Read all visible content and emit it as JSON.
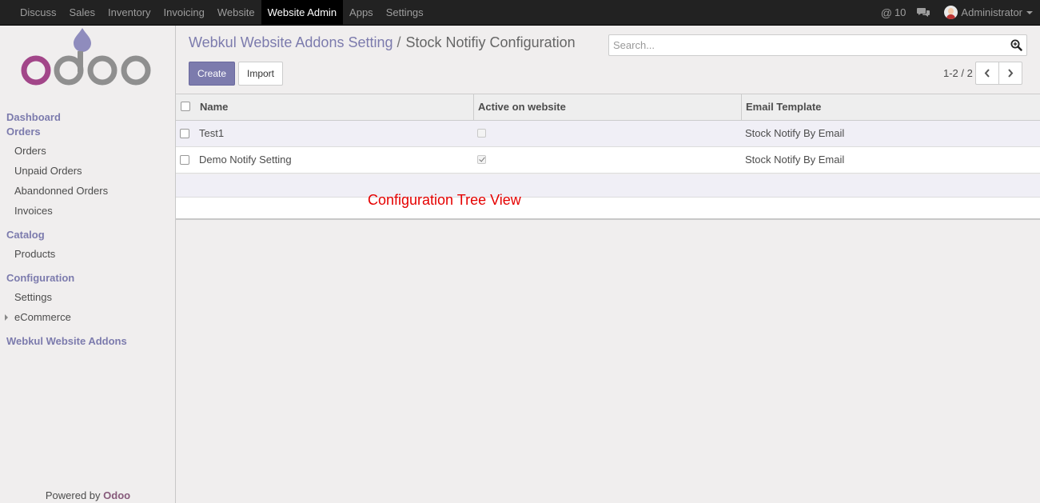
{
  "topbar": {
    "menu": [
      "Discuss",
      "Sales",
      "Inventory",
      "Invoicing",
      "Website",
      "Website Admin",
      "Apps",
      "Settings"
    ],
    "active_menu": "Website Admin",
    "mentions_count": "10",
    "mention_icon": "@",
    "user_name": "Administrator"
  },
  "sidebar": {
    "dashboard": "Dashboard",
    "orders_section": "Orders",
    "orders_items": [
      "Orders",
      "Unpaid Orders",
      "Abandonned Orders",
      "Invoices"
    ],
    "catalog_section": "Catalog",
    "catalog_items": [
      "Products"
    ],
    "configuration_section": "Configuration",
    "configuration_items": [
      "Settings",
      "eCommerce"
    ],
    "webkul_section": "Webkul Website Addons",
    "powered_prefix": "Powered by ",
    "powered_brand": "Odoo"
  },
  "breadcrumb": {
    "parent": "Webkul Website Addons Setting",
    "separator": "/",
    "current": "Stock Notifiy Configuration"
  },
  "search": {
    "placeholder": "Search..."
  },
  "buttons": {
    "create": "Create",
    "import": "Import"
  },
  "pager": {
    "value": "1-2 / 2"
  },
  "table": {
    "columns": [
      "Name",
      "Active on website",
      "Email Template"
    ],
    "rows": [
      {
        "name": "Test1",
        "active": false,
        "template": "Stock Notify By Email"
      },
      {
        "name": "Demo Notify Setting",
        "active": true,
        "template": "Stock Notify By Email"
      }
    ]
  },
  "annotation": "Configuration Tree View",
  "colors": {
    "navbar": "#222222",
    "accent": "#7c7bad",
    "brand": "#875a7b",
    "annotation": "#e50000"
  }
}
